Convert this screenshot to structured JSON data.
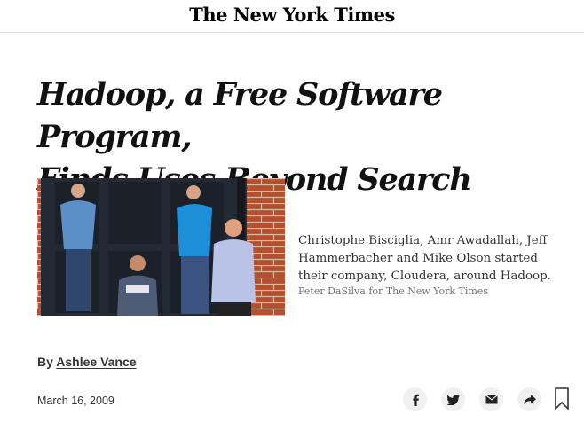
{
  "masthead": {
    "logo_text": "The New York Times"
  },
  "article": {
    "headline_line1": "Hadoop, a Free Software Program,",
    "headline_line2": "Finds Uses Beyond Search",
    "photo": {
      "caption": "Christophe Bisciglia, Amr Awadallah, Jeff Hammerbacher and Mike Olson started their company, Cloudera, around Hadoop.",
      "credit": "Peter DaSilva for The New York Times"
    },
    "byline_prefix": "By",
    "author": "Ashlee Vance",
    "date": "March 16, 2009"
  },
  "share": {
    "icons": [
      "facebook-icon",
      "twitter-icon",
      "email-icon",
      "share-arrow-icon",
      "bookmark-icon"
    ]
  },
  "colors": {
    "text": "#121212",
    "share_button_bg": "#f0f0f0",
    "credit": "#727272",
    "brick": "#b5502f",
    "door": "#20242c"
  }
}
